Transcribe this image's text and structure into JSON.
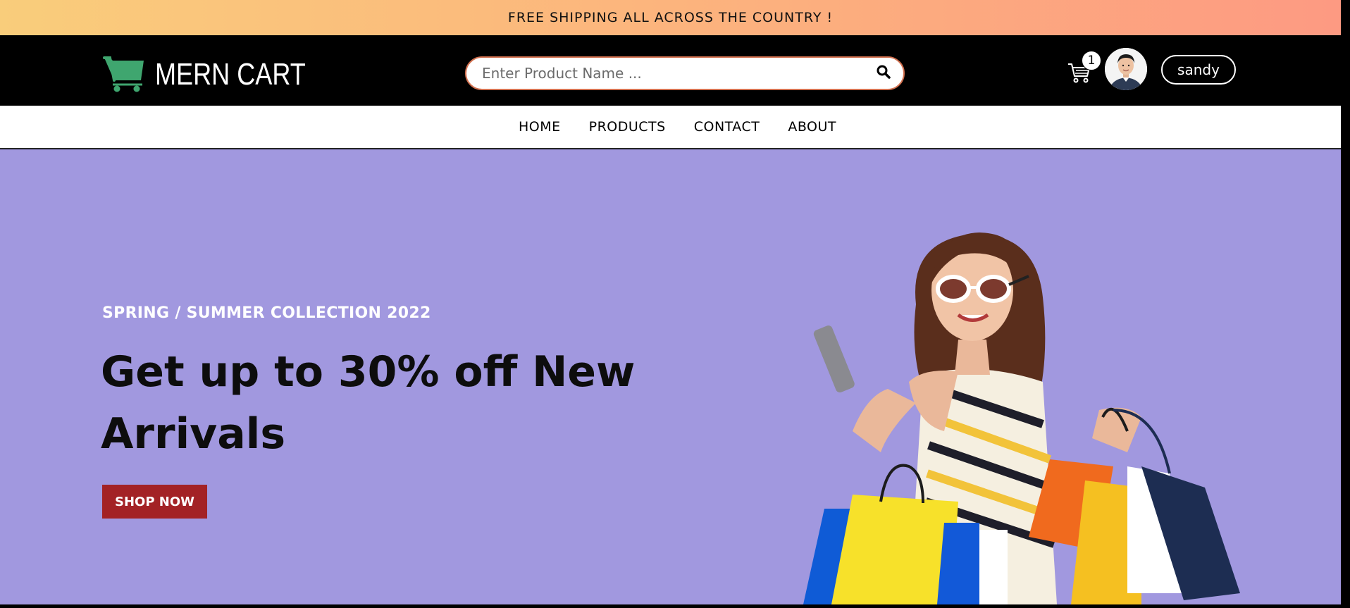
{
  "announcement": {
    "text": "FREE SHIPPING ALL ACROSS THE COUNTRY !"
  },
  "header": {
    "logo_text": "MERN CART",
    "logo_icon": "shopping-cart-icon",
    "search": {
      "placeholder": "Enter Product Name ...",
      "value": "",
      "icon": "search-icon"
    },
    "cart": {
      "icon": "cart-icon",
      "count": "1"
    },
    "avatar": {
      "icon": "user-avatar"
    },
    "user_name": "sandy"
  },
  "nav": {
    "items": [
      {
        "label": "HOME"
      },
      {
        "label": "PRODUCTS"
      },
      {
        "label": "CONTACT"
      },
      {
        "label": "ABOUT"
      }
    ]
  },
  "hero": {
    "subtitle": "SPRING / SUMMER COLLECTION 2022",
    "title": "Get up to 30% off New Arrivals",
    "cta_label": "SHOP NOW",
    "background_color": "#a198df",
    "cta_color": "#a32225"
  },
  "colors": {
    "brand_green": "#3fa66f",
    "search_border": "#d2704f",
    "announcement_start": "#f9cd7b",
    "announcement_end": "#fd9a82"
  }
}
